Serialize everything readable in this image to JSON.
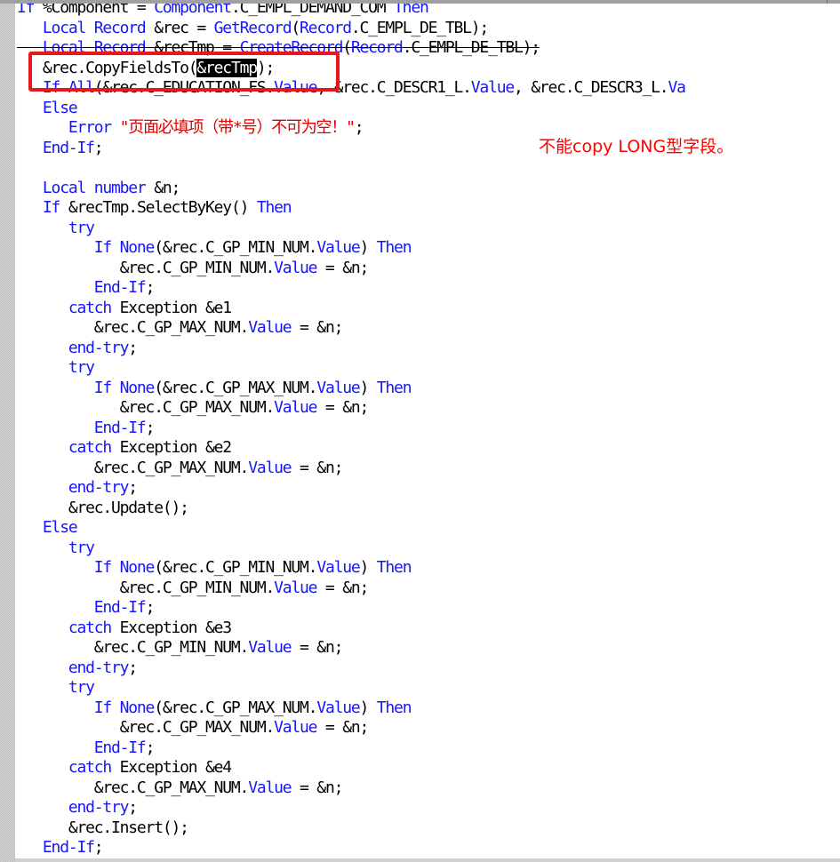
{
  "code": {
    "lines": [
      [
        {
          "t": "If ",
          "c": "kw"
        },
        {
          "t": "%Component = ",
          "c": "txt"
        },
        {
          "t": "Component",
          "c": "kw"
        },
        {
          "t": ".C_EMPL_DEMAND_COM ",
          "c": "txt"
        },
        {
          "t": "Then",
          "c": "kw"
        }
      ],
      [
        {
          "t": "   ",
          "c": "txt"
        },
        {
          "t": "Local Record ",
          "c": "kw"
        },
        {
          "t": "&rec = ",
          "c": "txt"
        },
        {
          "t": "GetRecord",
          "c": "kw"
        },
        {
          "t": "(",
          "c": "txt"
        },
        {
          "t": "Record",
          "c": "kw"
        },
        {
          "t": ".C_EMPL_DE_TBL);",
          "c": "txt"
        }
      ],
      [
        {
          "t": "   ",
          "c": "txt"
        },
        {
          "t": "Local Record ",
          "c": "kw"
        },
        {
          "t": "&recTmp = ",
          "c": "txt"
        },
        {
          "t": "CreateRecord",
          "c": "kw"
        },
        {
          "t": "(",
          "c": "txt"
        },
        {
          "t": "Record",
          "c": "kw"
        },
        {
          "t": ".C_EMPL_DE_TBL);",
          "c": "txt"
        }
      ],
      [
        {
          "t": "   &rec.CopyFieldsTo(",
          "c": "txt"
        },
        {
          "t": "&recTmp",
          "c": "sel"
        },
        {
          "t": ");",
          "c": "txt"
        }
      ],
      [
        {
          "t": "   ",
          "c": "txt"
        },
        {
          "t": "If All",
          "c": "kw"
        },
        {
          "t": "(&rec.C_EDUCATION_FS.",
          "c": "txt"
        },
        {
          "t": "Value",
          "c": "kw"
        },
        {
          "t": ", &rec.C_DESCR1_L.",
          "c": "txt"
        },
        {
          "t": "Value",
          "c": "kw"
        },
        {
          "t": ", &rec.C_DESCR3_L.",
          "c": "txt"
        },
        {
          "t": "Va",
          "c": "kw"
        }
      ],
      [
        {
          "t": "   ",
          "c": "txt"
        },
        {
          "t": "Else",
          "c": "kw"
        }
      ],
      [
        {
          "t": "      ",
          "c": "txt"
        },
        {
          "t": "Error ",
          "c": "kw"
        },
        {
          "t": "\"页面必填项（带*号）不可为空！\"",
          "c": "str"
        },
        {
          "t": ";",
          "c": "txt"
        }
      ],
      [
        {
          "t": "   ",
          "c": "txt"
        },
        {
          "t": "End-If",
          "c": "kw"
        },
        {
          "t": ";",
          "c": "txt"
        }
      ],
      [],
      [
        {
          "t": "   ",
          "c": "txt"
        },
        {
          "t": "Local number ",
          "c": "kw"
        },
        {
          "t": "&n;",
          "c": "txt"
        }
      ],
      [
        {
          "t": "   ",
          "c": "txt"
        },
        {
          "t": "If ",
          "c": "kw"
        },
        {
          "t": "&recTmp.SelectByKey() ",
          "c": "txt"
        },
        {
          "t": "Then",
          "c": "kw"
        }
      ],
      [
        {
          "t": "      ",
          "c": "txt"
        },
        {
          "t": "try",
          "c": "kw"
        }
      ],
      [
        {
          "t": "         ",
          "c": "txt"
        },
        {
          "t": "If None",
          "c": "kw"
        },
        {
          "t": "(&rec.C_GP_MIN_NUM.",
          "c": "txt"
        },
        {
          "t": "Value",
          "c": "kw"
        },
        {
          "t": ") ",
          "c": "txt"
        },
        {
          "t": "Then",
          "c": "kw"
        }
      ],
      [
        {
          "t": "            &rec.C_GP_MIN_NUM.",
          "c": "txt"
        },
        {
          "t": "Value",
          "c": "kw"
        },
        {
          "t": " = &n;",
          "c": "txt"
        }
      ],
      [
        {
          "t": "         ",
          "c": "txt"
        },
        {
          "t": "End-If",
          "c": "kw"
        },
        {
          "t": ";",
          "c": "txt"
        }
      ],
      [
        {
          "t": "      ",
          "c": "txt"
        },
        {
          "t": "catch ",
          "c": "kw"
        },
        {
          "t": "Exception &e1",
          "c": "txt"
        }
      ],
      [
        {
          "t": "         &rec.C_GP_MAX_NUM.",
          "c": "txt"
        },
        {
          "t": "Value",
          "c": "kw"
        },
        {
          "t": " = &n;",
          "c": "txt"
        }
      ],
      [
        {
          "t": "      ",
          "c": "txt"
        },
        {
          "t": "end-try",
          "c": "kw"
        },
        {
          "t": ";",
          "c": "txt"
        }
      ],
      [
        {
          "t": "      ",
          "c": "txt"
        },
        {
          "t": "try",
          "c": "kw"
        }
      ],
      [
        {
          "t": "         ",
          "c": "txt"
        },
        {
          "t": "If None",
          "c": "kw"
        },
        {
          "t": "(&rec.C_GP_MAX_NUM.",
          "c": "txt"
        },
        {
          "t": "Value",
          "c": "kw"
        },
        {
          "t": ") ",
          "c": "txt"
        },
        {
          "t": "Then",
          "c": "kw"
        }
      ],
      [
        {
          "t": "            &rec.C_GP_MAX_NUM.",
          "c": "txt"
        },
        {
          "t": "Value",
          "c": "kw"
        },
        {
          "t": " = &n;",
          "c": "txt"
        }
      ],
      [
        {
          "t": "         ",
          "c": "txt"
        },
        {
          "t": "End-If",
          "c": "kw"
        },
        {
          "t": ";",
          "c": "txt"
        }
      ],
      [
        {
          "t": "      ",
          "c": "txt"
        },
        {
          "t": "catch ",
          "c": "kw"
        },
        {
          "t": "Exception &e2",
          "c": "txt"
        }
      ],
      [
        {
          "t": "         &rec.C_GP_MAX_NUM.",
          "c": "txt"
        },
        {
          "t": "Value",
          "c": "kw"
        },
        {
          "t": " = &n;",
          "c": "txt"
        }
      ],
      [
        {
          "t": "      ",
          "c": "txt"
        },
        {
          "t": "end-try",
          "c": "kw"
        },
        {
          "t": ";",
          "c": "txt"
        }
      ],
      [
        {
          "t": "      &rec.Update();",
          "c": "txt"
        }
      ],
      [
        {
          "t": "   ",
          "c": "txt"
        },
        {
          "t": "Else",
          "c": "kw"
        }
      ],
      [
        {
          "t": "      ",
          "c": "txt"
        },
        {
          "t": "try",
          "c": "kw"
        }
      ],
      [
        {
          "t": "         ",
          "c": "txt"
        },
        {
          "t": "If None",
          "c": "kw"
        },
        {
          "t": "(&rec.C_GP_MIN_NUM.",
          "c": "txt"
        },
        {
          "t": "Value",
          "c": "kw"
        },
        {
          "t": ") ",
          "c": "txt"
        },
        {
          "t": "Then",
          "c": "kw"
        }
      ],
      [
        {
          "t": "            &rec.C_GP_MIN_NUM.",
          "c": "txt"
        },
        {
          "t": "Value",
          "c": "kw"
        },
        {
          "t": " = &n;",
          "c": "txt"
        }
      ],
      [
        {
          "t": "         ",
          "c": "txt"
        },
        {
          "t": "End-If",
          "c": "kw"
        },
        {
          "t": ";",
          "c": "txt"
        }
      ],
      [
        {
          "t": "      ",
          "c": "txt"
        },
        {
          "t": "catch ",
          "c": "kw"
        },
        {
          "t": "Exception &e3",
          "c": "txt"
        }
      ],
      [
        {
          "t": "         &rec.C_GP_MIN_NUM.",
          "c": "txt"
        },
        {
          "t": "Value",
          "c": "kw"
        },
        {
          "t": " = &n;",
          "c": "txt"
        }
      ],
      [
        {
          "t": "      ",
          "c": "txt"
        },
        {
          "t": "end-try",
          "c": "kw"
        },
        {
          "t": ";",
          "c": "txt"
        }
      ],
      [
        {
          "t": "      ",
          "c": "txt"
        },
        {
          "t": "try",
          "c": "kw"
        }
      ],
      [
        {
          "t": "         ",
          "c": "txt"
        },
        {
          "t": "If None",
          "c": "kw"
        },
        {
          "t": "(&rec.C_GP_MAX_NUM.",
          "c": "txt"
        },
        {
          "t": "Value",
          "c": "kw"
        },
        {
          "t": ") ",
          "c": "txt"
        },
        {
          "t": "Then",
          "c": "kw"
        }
      ],
      [
        {
          "t": "            &rec.C_GP_MAX_NUM.",
          "c": "txt"
        },
        {
          "t": "Value",
          "c": "kw"
        },
        {
          "t": " = &n;",
          "c": "txt"
        }
      ],
      [
        {
          "t": "         ",
          "c": "txt"
        },
        {
          "t": "End-If",
          "c": "kw"
        },
        {
          "t": ";",
          "c": "txt"
        }
      ],
      [
        {
          "t": "      ",
          "c": "txt"
        },
        {
          "t": "catch ",
          "c": "kw"
        },
        {
          "t": "Exception &e4",
          "c": "txt"
        }
      ],
      [
        {
          "t": "         &rec.C_GP_MAX_NUM.",
          "c": "txt"
        },
        {
          "t": "Value",
          "c": "kw"
        },
        {
          "t": " = &n;",
          "c": "txt"
        }
      ],
      [
        {
          "t": "      ",
          "c": "txt"
        },
        {
          "t": "end-try",
          "c": "kw"
        },
        {
          "t": ";",
          "c": "txt"
        }
      ],
      [
        {
          "t": "      &rec.Insert();",
          "c": "txt"
        }
      ],
      [
        {
          "t": "   ",
          "c": "txt"
        },
        {
          "t": "End-If",
          "c": "kw"
        },
        {
          "t": ";",
          "c": "txt"
        }
      ]
    ],
    "selected_token": "&recTmp"
  },
  "annotation": {
    "note": "不能copy LONG型字段。",
    "box_color": "#e8181a",
    "note_color": "#ff0000"
  },
  "colors": {
    "keyword": "#1515ff",
    "text": "#000000",
    "string": "#e00000"
  }
}
